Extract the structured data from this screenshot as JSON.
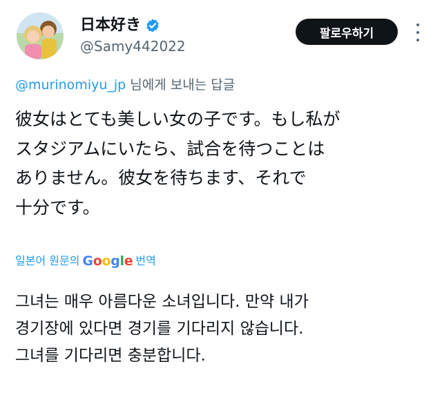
{
  "author": {
    "display_name": "日本好き",
    "handle": "@Samy442022",
    "verified": true
  },
  "follow_button_label": "팔로우하기",
  "reply": {
    "mention": "@murinomiyu_jp",
    "suffix": " 님에게 보내는 답글"
  },
  "tweet": {
    "lines": [
      "彼女はとても美しい女の子です。もし私が",
      "スタジアムにいたら、試合を待つことは",
      "ありません。彼女を待ちます、それで",
      "十分です。"
    ]
  },
  "translation": {
    "prefix": "일본어 원문의",
    "service": "Google",
    "suffix": "번역",
    "lines": [
      "그녀는 매우 아름다운 소녀입니다. 만약 내가",
      "경기장에 있다면 경기를 기다리지 않습니다.",
      "그녀를 기다리면 충분합니다."
    ]
  },
  "colors": {
    "link": "#1d9bf0",
    "secondary_text": "#536471",
    "button_bg": "#0f1419",
    "verified_badge": "#1d9bf0"
  },
  "icons": [
    "verified-badge-icon",
    "more-options-icon",
    "google-logo"
  ]
}
